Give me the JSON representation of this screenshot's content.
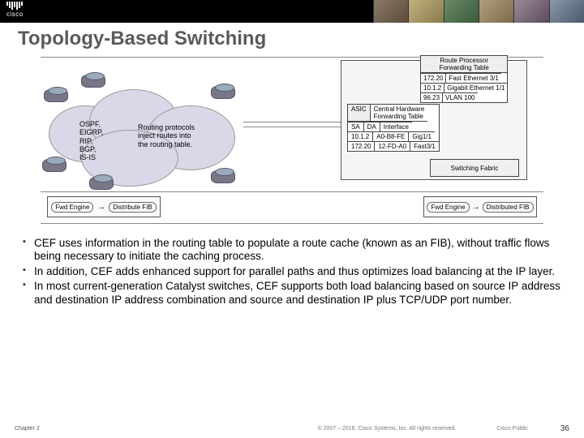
{
  "brand": "cisco",
  "title": "Topology-Based Switching",
  "cloud": {
    "protocols": "OSPF,\nEIGRP,\nRIP,\nBGP,\nIS-IS",
    "routing_note": "Routing protocols\ninject routes into\nthe routing table."
  },
  "rpft": {
    "title": "Route Processor\nForwarding Table",
    "rows": [
      [
        "172.20",
        "Fast Ethernet 3/1"
      ],
      [
        "10.1.2",
        "Gigabit Ethernet 1/1"
      ],
      [
        "96.23",
        "VLAN 100"
      ]
    ]
  },
  "asic": {
    "label_left": "ASIC",
    "label_right": "Central Hardware\nForwarding Table",
    "header": [
      "SA",
      "DA",
      "Interface"
    ],
    "rows": [
      [
        "10.1.2",
        "A0-B8-FE",
        "Gig1/1"
      ],
      [
        "172.20",
        "12-FD-A0",
        "Fast3/1"
      ]
    ]
  },
  "fabric_label": "Switching Fabric",
  "linecards": {
    "card1": {
      "a": "Fwd Engine",
      "b": "Distribute FIB"
    },
    "card2": {
      "a": "Fwd Engine",
      "b": "Distributed FIB"
    }
  },
  "bullets": [
    "CEF uses information in the routing table to populate a route cache (known as an FIB), without traffic flows being necessary to initiate the caching process.",
    "In addition, CEF adds enhanced support for parallel paths and thus optimizes load balancing at the IP layer.",
    "In most current-generation Catalyst switches, CEF supports both load balancing based on source IP address and destination IP address combination and source and destination IP plus TCP/UDP port number."
  ],
  "footer": {
    "chapter": "Chapter 2",
    "copyright": "© 2007 – 2016, Cisco Systems, Inc. All rights reserved.",
    "public": "Cisco Public",
    "page": "36"
  }
}
